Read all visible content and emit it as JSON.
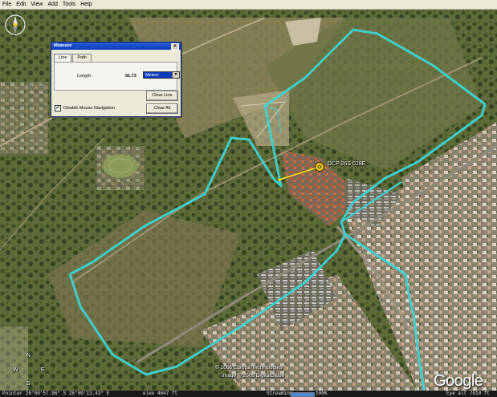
{
  "menu": {
    "items": [
      "File",
      "Edit",
      "View",
      "Add",
      "Tools",
      "Help"
    ]
  },
  "map": {
    "placemark_label": "DCP 26S 028E",
    "copyright_lines": [
      "© 2006 Europa Technologies",
      "Image © 2006 DigitalGlobe"
    ],
    "logo_text": "Google",
    "compass": {
      "n": "N",
      "s": "S",
      "e": "E",
      "w": "W"
    },
    "track_color": "#3fd3d0",
    "measure_line_color": "#ffe600"
  },
  "measure_dialog": {
    "title": "Measure",
    "tabs": [
      "Line",
      "Path"
    ],
    "length_label": "Length:",
    "length_value": "91.73",
    "unit_selected": "Meters",
    "clear_line_label": "Clear Line",
    "clear_all_label": "Clear All",
    "disable_nav_label": "Disable Mouse Navigation",
    "disable_nav_checked": true
  },
  "status": {
    "pointer": "Pointer  26°00'57.96\" S    28°00'13.43\" E",
    "elevation": "elev  4647 ft",
    "streaming_label": "Streaming",
    "streaming_percent": "100%",
    "eye_alt": "Eye  alt     7810 ft"
  }
}
